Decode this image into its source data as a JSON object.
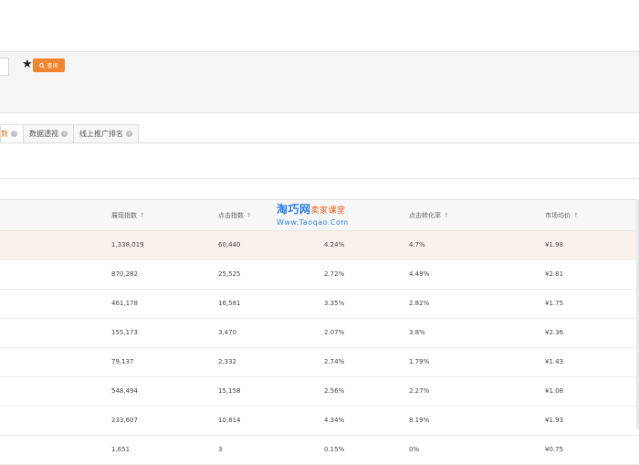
{
  "search": {
    "query_button_label": "查询"
  },
  "tabs": [
    {
      "label": "数",
      "active": true
    },
    {
      "label": "数据透视",
      "active": false
    },
    {
      "label": "线上推广排名",
      "active": false
    }
  ],
  "table": {
    "headers": [
      "展现指数",
      "点击指数",
      "点击转化率",
      "市场均价"
    ],
    "rows": [
      [
        "1,338,019",
        "60,440",
        "4.24%",
        "4.7%",
        "¥1.98"
      ],
      [
        "870,282",
        "25,525",
        "2.72%",
        "4.49%",
        "¥2.81"
      ],
      [
        "461,178",
        "16,581",
        "3.35%",
        "2.82%",
        "¥1.75"
      ],
      [
        "155,173",
        "3,470",
        "2.07%",
        "3.8%",
        "¥2.36"
      ],
      [
        "79,137",
        "2,332",
        "2.74%",
        "1.79%",
        "¥1.43"
      ],
      [
        "548,494",
        "15,158",
        "2.56%",
        "2.27%",
        "¥1.08"
      ],
      [
        "233,607",
        "10,814",
        "4.34%",
        "8.19%",
        "¥1.93"
      ],
      [
        "1,651",
        "3",
        "0.15%",
        "0%",
        "¥0.75"
      ]
    ]
  },
  "watermark": {
    "line1_blue": "淘巧网",
    "line1_red": "卖家课堂",
    "line2": "Www.Taoqao.Com"
  },
  "colors": {
    "accent": "#f0852f",
    "highlight_row": "#fbf1ec",
    "watermark_blue": "#2a7de1"
  }
}
